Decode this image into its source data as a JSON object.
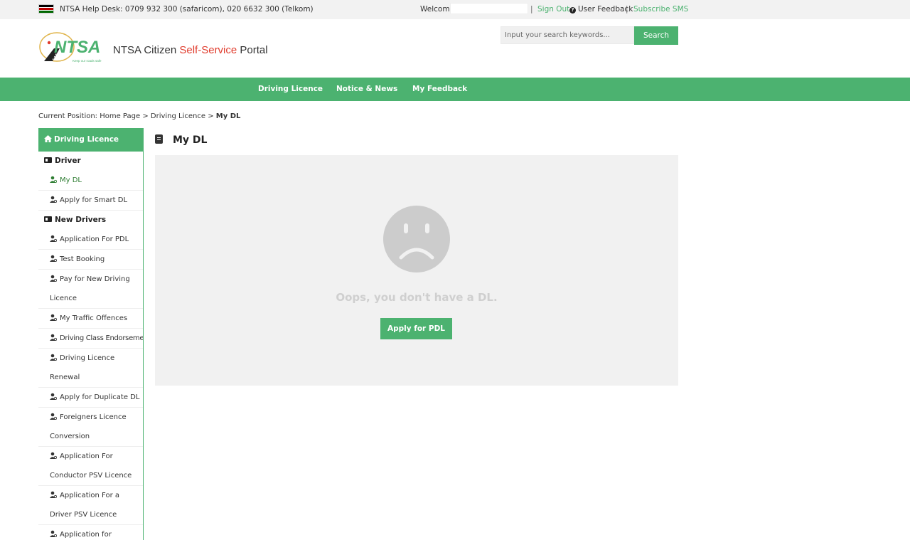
{
  "topbar": {
    "helpdesk": "NTSA Help Desk: 0709 932 300 (safaricom), 020 6632 300 (Telkom)",
    "welcome": "Welcome",
    "sign_out": "Sign Out",
    "user_feedback": "User Feedback",
    "subscribe_sms": "Subscribe SMS",
    "separator": "|"
  },
  "header": {
    "logo_text": "NTSA",
    "logo_tagline": "Keep our roads safe",
    "title_prefix": "NTSA Citizen ",
    "title_highlight": "Self-Service",
    "title_suffix": " Portal",
    "search_placeholder": "Input your search keywords...",
    "search_button": "Search"
  },
  "nav": {
    "items": [
      "Driving Licence",
      "Notice & News",
      "My Feedback"
    ]
  },
  "breadcrumb": {
    "prefix": "Current Position: Home Page > Driving Licence > ",
    "current": "My DL"
  },
  "sidebar": {
    "header": "Driving Licence",
    "groups": [
      {
        "label": "Driver"
      },
      {
        "label": "New Drivers"
      }
    ],
    "driver_items": [
      "My DL",
      "Apply for Smart DL"
    ],
    "new_driver_items": [
      "Application For PDL",
      "Test Booking",
      "Pay for New Driving Licence",
      "My Traffic Offences",
      "Driving Class Endorsement",
      "Driving Licence Renewal",
      "Apply for Duplicate DL",
      "Foreigners Licence Conversion",
      "Application For Conductor PSV Licence",
      "Application For a Driver PSV Licence",
      "Application for Duplicate Badge"
    ]
  },
  "content": {
    "title": "My DL",
    "message": "Oops, you don't have a DL.",
    "apply_button": "Apply for PDL"
  },
  "colors": {
    "brand_green": "#4cb270",
    "accent_red": "#e03b2c",
    "panel_bg": "#f1f1f1"
  }
}
